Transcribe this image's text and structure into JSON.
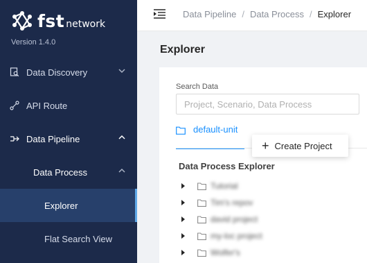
{
  "app": {
    "brand": "fst",
    "brand_suffix": "network",
    "version": "Version 1.4.0"
  },
  "sidebar": {
    "items": [
      {
        "label": "Data Discovery"
      },
      {
        "label": "API Route"
      },
      {
        "label": "Data Pipeline"
      },
      {
        "label": "Data Process"
      },
      {
        "label": "Explorer"
      },
      {
        "label": "Flat Search View"
      }
    ]
  },
  "breadcrumb": [
    "Data Pipeline",
    "Data Process",
    "Explorer"
  ],
  "page": {
    "title": "Explorer"
  },
  "search": {
    "label": "Search Data",
    "placeholder": "Project, Scenario, Data Process",
    "value": ""
  },
  "tabs": [
    {
      "label": "default-unit"
    }
  ],
  "popover": {
    "label": "Create Project"
  },
  "explorer": {
    "title": "Data Process Explorer",
    "items": [
      "Tutorial",
      "Tim's repov",
      "david project",
      "my-loc project",
      "Wolfer's"
    ]
  },
  "colors": {
    "sidebar_bg": "#1c2a4a",
    "active_bg": "#27406b",
    "accent": "#1890ff",
    "active_indicator": "#5ea8e8"
  }
}
